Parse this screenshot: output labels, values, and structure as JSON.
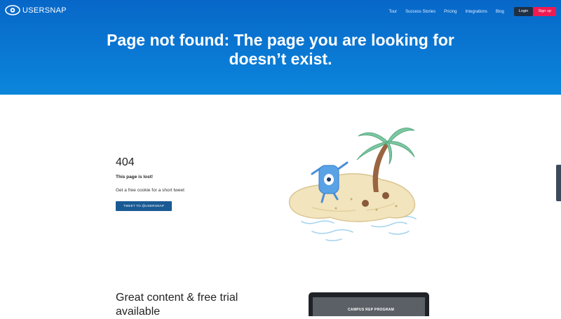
{
  "brand": {
    "name": "USERSNAP"
  },
  "nav": {
    "links": [
      "Tour",
      "Success Stories",
      "Pricing",
      "Integrations",
      "Blog"
    ],
    "login_label": "Login",
    "signup_label": "Sign up"
  },
  "hero": {
    "title_line1": "Page not found: The page you are looking for",
    "title_line2": "doesn’t exist."
  },
  "error": {
    "code": "404",
    "subtitle": "This page is lost!",
    "description": "Get a free cookie for a short tweet",
    "tweet_label": "TWEET TO @USERSNAP"
  },
  "bottom": {
    "title": "Great content & free trial available",
    "promo_label": "CAMPUS REP PROGRAM"
  },
  "colors": {
    "hero": "#0a78d3",
    "signup": "#f01a52",
    "login": "#1f2f44",
    "tweet": "#1a5a94"
  }
}
